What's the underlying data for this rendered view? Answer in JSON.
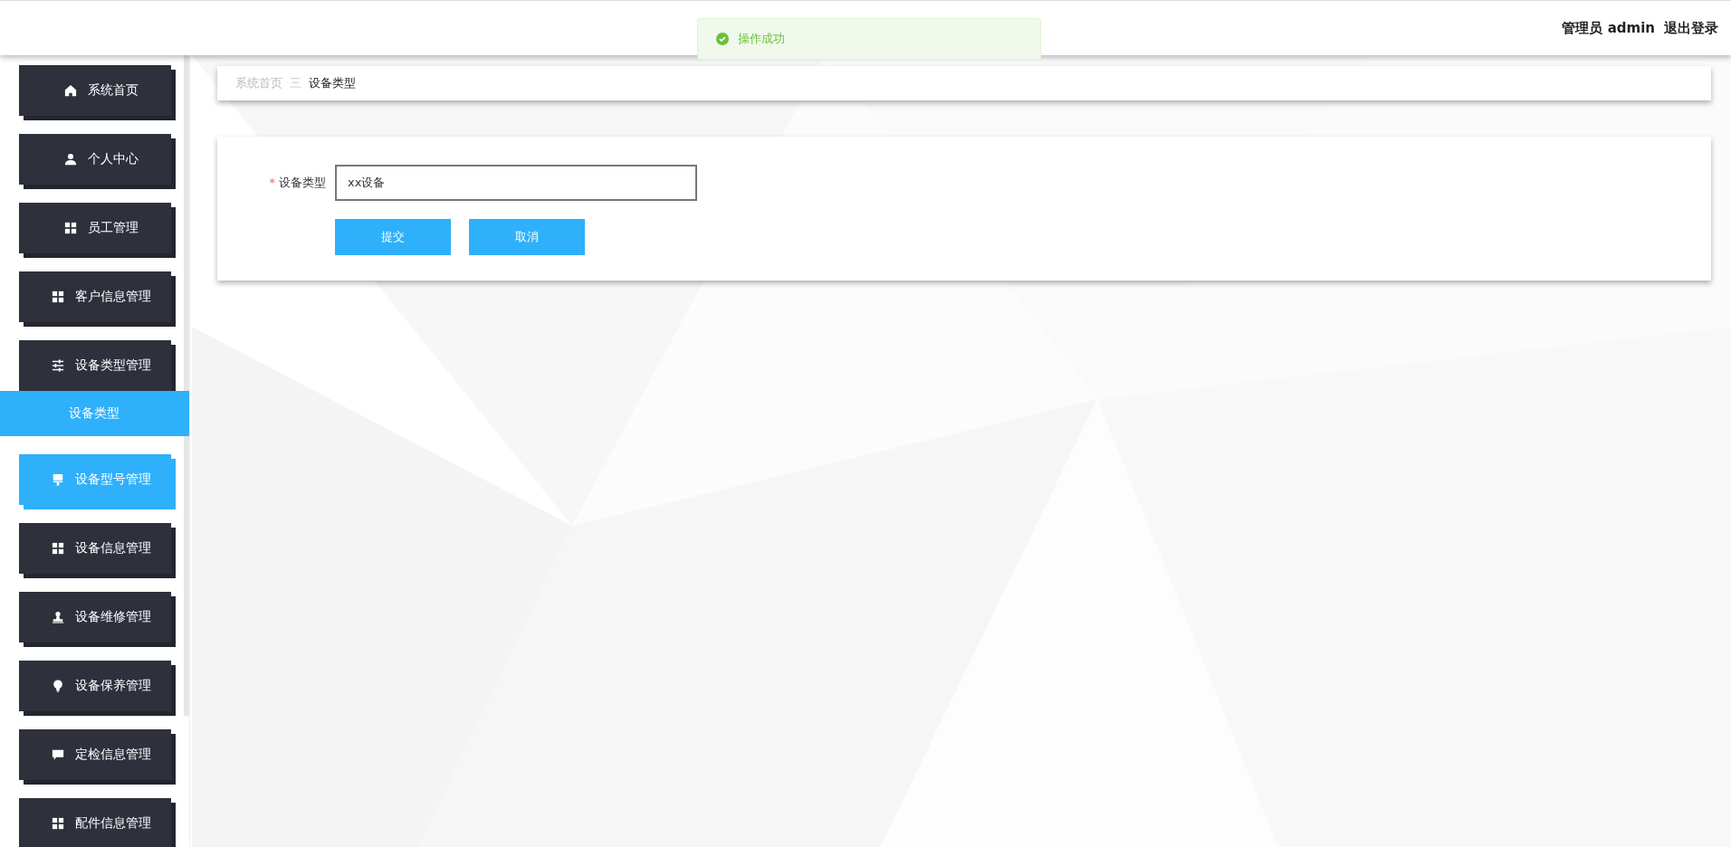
{
  "header": {
    "user_label": "管理员 admin",
    "logout": "退出登录"
  },
  "toast": {
    "message": "操作成功"
  },
  "sidebar": {
    "items": [
      {
        "label": "系统首页",
        "kind": "home",
        "highlighted": false
      },
      {
        "label": "个人中心",
        "kind": "user",
        "highlighted": false
      },
      {
        "label": "员工管理",
        "kind": "grid",
        "highlighted": false
      },
      {
        "label": "客户信息管理",
        "kind": "grid",
        "highlighted": false
      },
      {
        "label": "设备类型管理",
        "kind": "sliders",
        "highlighted": false,
        "expanded": true,
        "children": [
          {
            "label": "设备类型",
            "selected": true
          }
        ]
      },
      {
        "label": "设备型号管理",
        "kind": "brush",
        "highlighted": true
      },
      {
        "label": "设备信息管理",
        "kind": "grid",
        "highlighted": false
      },
      {
        "label": "设备维修管理",
        "kind": "stamp",
        "highlighted": false
      },
      {
        "label": "设备保养管理",
        "kind": "bulb",
        "highlighted": false
      },
      {
        "label": "定检信息管理",
        "kind": "chat",
        "highlighted": false
      },
      {
        "label": "配件信息管理",
        "kind": "grid",
        "highlighted": false
      }
    ]
  },
  "breadcrumb": [
    "系统首页",
    "设备类型"
  ],
  "breadcrumb_separator": "三",
  "form": {
    "fields": [
      {
        "label": "设备类型",
        "required_mark": "*",
        "value": "xx设备"
      }
    ],
    "buttons": [
      "提交",
      "取消"
    ]
  }
}
